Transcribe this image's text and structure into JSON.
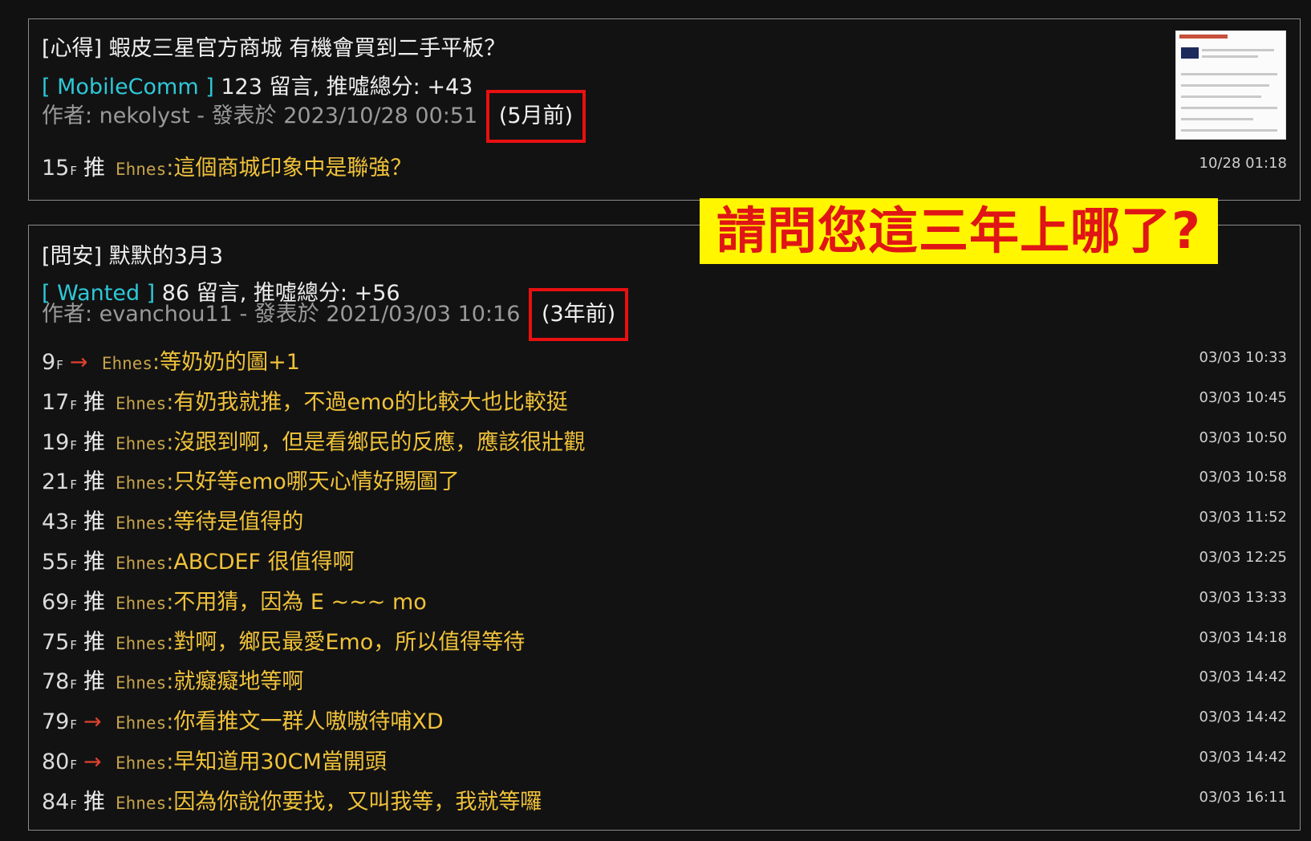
{
  "post1": {
    "title": "[心得] 蝦皮三星官方商城 有機會買到二手平板？",
    "board": "[ MobileComm ]",
    "stats": " 123 留言, 推噓總分: +43",
    "author_line": "作者: nekolyst - 發表於 2023/10/28 00:51",
    "ago": "(5月前)",
    "comments": [
      {
        "floor": "15",
        "tag": "推",
        "user": "Ehnes",
        "msg": "這個商城印象中是聯強？",
        "time": "10/28 01:18"
      }
    ]
  },
  "post2": {
    "title": "[問安] 默默的3月3",
    "board": "[ Wanted ]",
    "stats": " 86 留言, 推噓總分: +56",
    "author_line": "作者: evanchou11 - 發表於 2021/03/03 10:16",
    "ago": "(3年前)",
    "comments": [
      {
        "floor": "9",
        "tag": "→",
        "user": "Ehnes",
        "msg": "等奶奶的圖+1",
        "time": "03/03 10:33"
      },
      {
        "floor": "17",
        "tag": "推",
        "user": "Ehnes",
        "msg": "有奶我就推，不過emo的比較大也比較挺",
        "time": "03/03 10:45"
      },
      {
        "floor": "19",
        "tag": "推",
        "user": "Ehnes",
        "msg": "沒跟到啊，但是看鄉民的反應，應該很壯觀",
        "time": "03/03 10:50"
      },
      {
        "floor": "21",
        "tag": "推",
        "user": "Ehnes",
        "msg": "只好等emo哪天心情好賜圖了",
        "time": "03/03 10:58"
      },
      {
        "floor": "43",
        "tag": "推",
        "user": "Ehnes",
        "msg": "等待是值得的",
        "time": "03/03 11:52"
      },
      {
        "floor": "55",
        "tag": "推",
        "user": "Ehnes",
        "msg": "ABCDEF 很值得啊",
        "time": "03/03 12:25"
      },
      {
        "floor": "69",
        "tag": "推",
        "user": "Ehnes",
        "msg": "不用猜，因為 E ~~~ mo",
        "time": "03/03 13:33"
      },
      {
        "floor": "75",
        "tag": "推",
        "user": "Ehnes",
        "msg": "對啊，鄉民最愛Emo，所以值得等待",
        "time": "03/03 14:18"
      },
      {
        "floor": "78",
        "tag": "推",
        "user": "Ehnes",
        "msg": "就癡癡地等啊",
        "time": "03/03 14:42"
      },
      {
        "floor": "79",
        "tag": "→",
        "user": "Ehnes",
        "msg": "你看推文一群人嗷嗷待哺XD",
        "time": "03/03 14:42"
      },
      {
        "floor": "80",
        "tag": "→",
        "user": "Ehnes",
        "msg": "早知道用30CM當開頭",
        "time": "03/03 14:42"
      },
      {
        "floor": "84",
        "tag": "推",
        "user": "Ehnes",
        "msg": "因為你說你要找，又叫我等，我就等囉",
        "time": "03/03 16:11"
      }
    ]
  },
  "banner": "請問您這三年上哪了?",
  "floor_suffix": "F",
  "colon": ":"
}
